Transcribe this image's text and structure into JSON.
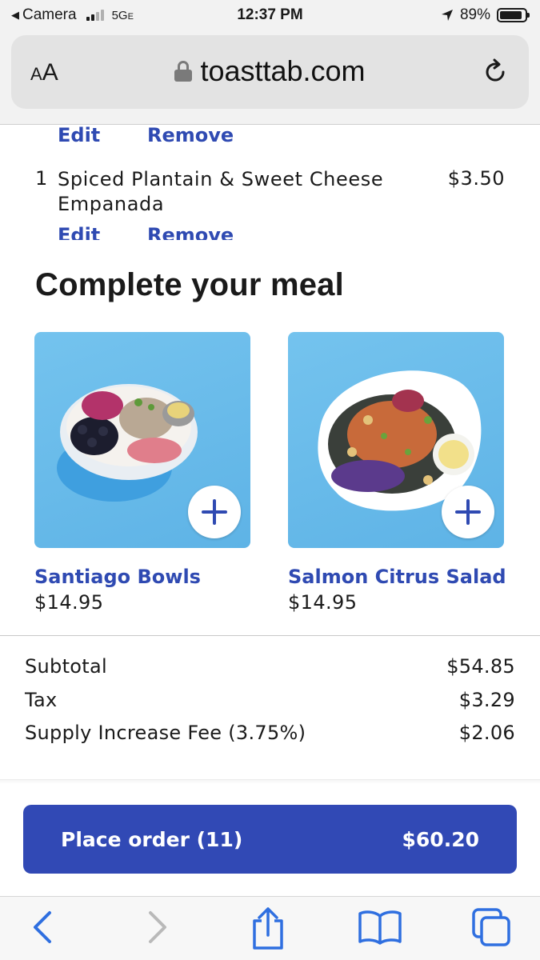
{
  "status_bar": {
    "back_app": "Camera",
    "network": "5G",
    "network_suffix": "E",
    "time": "12:37 PM",
    "battery": "89%",
    "battery_level": 0.89
  },
  "address_bar": {
    "text_size_label": "A",
    "text_size_label_large": "A",
    "url": "toasttab.com"
  },
  "cart": {
    "edit_label": "Edit",
    "remove_label": "Remove",
    "items": [
      {
        "qty": "1",
        "name": "Spiced Plantain & Sweet Cheese Empanada",
        "price": "$3.50"
      }
    ]
  },
  "upsell": {
    "title": "Complete your meal",
    "cards": [
      {
        "name": "Santiago Bowls",
        "price": "$14.95"
      },
      {
        "name": "Salmon Citrus Salad",
        "price": "$14.95"
      }
    ]
  },
  "totals": {
    "rows": [
      {
        "label": "Subtotal",
        "value": "$54.85"
      },
      {
        "label": "Tax",
        "value": "$3.29"
      },
      {
        "label": "Supply Increase Fee (3.75%)",
        "value": "$2.06"
      }
    ]
  },
  "place_order": {
    "label": "Place order (11)",
    "amount": "$60.20"
  },
  "toolbar": {
    "icons": [
      "back-icon",
      "forward-icon",
      "share-icon",
      "bookmarks-icon",
      "tabs-icon"
    ]
  },
  "colors": {
    "accent": "#2f4ab2",
    "button": "#3149b5",
    "tile_bg": "#6bbbeb"
  }
}
